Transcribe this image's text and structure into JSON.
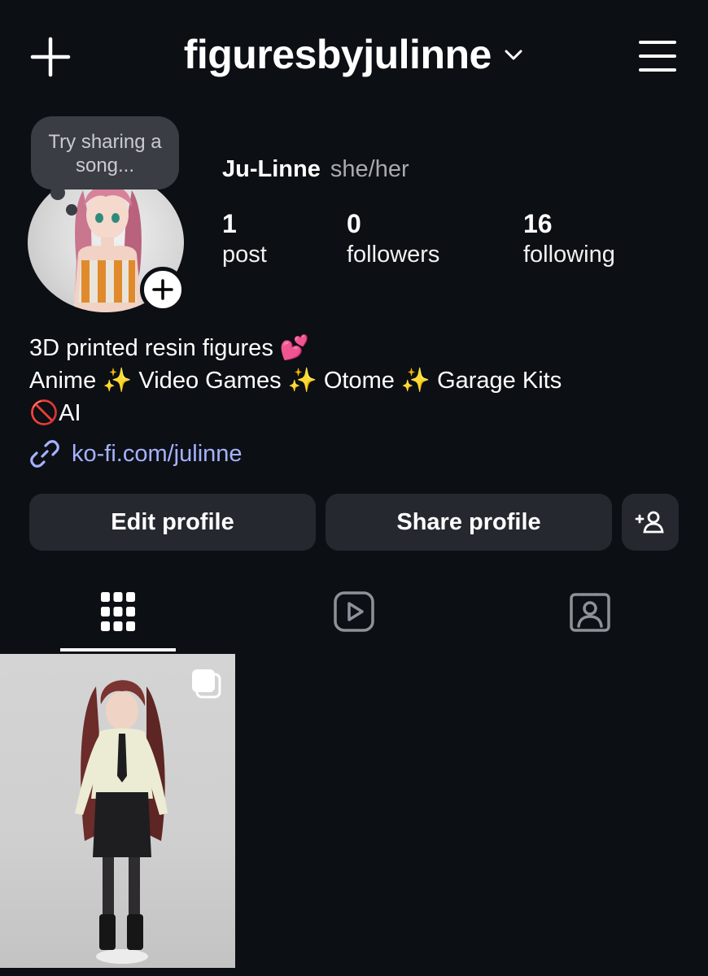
{
  "header": {
    "username": "figuresbyjulinne",
    "icons": {
      "new_post": "plus-icon",
      "account_switch": "chevron-down-icon",
      "menu": "hamburger-menu-icon"
    }
  },
  "profile": {
    "note_placeholder": "Try sharing a song...",
    "display_name": "Ju-Linne",
    "pronouns": "she/her",
    "stats": [
      {
        "value": "1",
        "label": "post"
      },
      {
        "value": "0",
        "label": "followers"
      },
      {
        "value": "16",
        "label": "following"
      }
    ],
    "bio_lines": [
      "3D printed resin figures 💕",
      "Anime ✨ Video Games ✨ Otome ✨ Garage Kits",
      "🚫AI"
    ],
    "link": "ko-fi.com/julinne"
  },
  "actions": {
    "edit_label": "Edit profile",
    "share_label": "Share profile",
    "discover_icon": "add-person-icon"
  },
  "tabs": [
    {
      "name": "posts",
      "icon": "grid-icon",
      "active": true
    },
    {
      "name": "reels",
      "icon": "reels-icon",
      "active": false
    },
    {
      "name": "tagged",
      "icon": "tagged-person-icon",
      "active": false
    }
  ],
  "posts": [
    {
      "type": "carousel",
      "icon": "carousel-icon"
    }
  ],
  "colors": {
    "background": "#0c0f14",
    "button_bg": "#25282e",
    "link": "#a5b2ff",
    "note_bubble": "#3a3d43"
  }
}
